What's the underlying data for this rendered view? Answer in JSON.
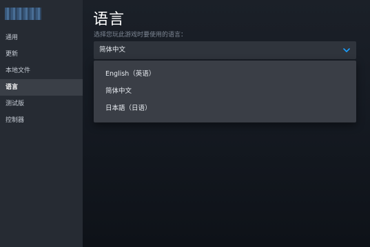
{
  "nav": {
    "items": [
      {
        "label": "通用"
      },
      {
        "label": "更新"
      },
      {
        "label": "本地文件"
      },
      {
        "label": "语言"
      },
      {
        "label": "测试版"
      },
      {
        "label": "控制器"
      }
    ],
    "active_index": 3
  },
  "main": {
    "title": "语言",
    "subtitle": "选择您玩此游戏时要使用的语言：",
    "select": {
      "value": "简体中文",
      "icon": "chevron-down-icon",
      "options": [
        {
          "label": "English（英语）"
        },
        {
          "label": "简体中文"
        },
        {
          "label": "日本語（日语）"
        }
      ]
    }
  },
  "colors": {
    "sidebar_bg": "#262b33",
    "sidebar_active_bg": "#3a3f47",
    "select_bg": "#2f343c",
    "dropdown_bg": "#3a3e46",
    "accent_chevron": "#1a9fff"
  }
}
